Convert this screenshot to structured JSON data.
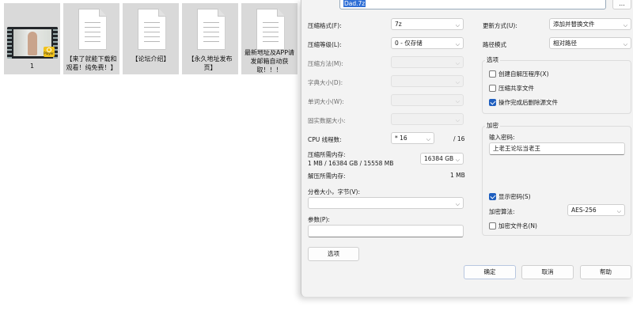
{
  "files": [
    {
      "name": "1",
      "type": "video"
    },
    {
      "name": "【来了就能下载和观看！纯免费！】",
      "type": "document"
    },
    {
      "name": "【论坛介绍】",
      "type": "document"
    },
    {
      "name": "【永久地址发布页】",
      "type": "document"
    },
    {
      "name": "最新地址及APP请发邮箱自动获取！！！",
      "type": "document"
    }
  ],
  "dialog": {
    "archive_name": "Dad.7z",
    "archive_browse": "...",
    "format_label": "压缩格式(F):",
    "format_value": "7z",
    "level_label": "压缩等级(L):",
    "level_value": "0 - 仅存储",
    "method_label": "压缩方法(M):",
    "dict_label": "字典大小(D):",
    "word_label": "单词大小(W):",
    "solid_label": "固实数据大小:",
    "cpu_label": "CPU 线程数:",
    "cpu_value": "* 16",
    "cpu_total": "/ 16",
    "mem_comp_label": "压缩所需内存:",
    "mem_comp_detail": "1 MB / 16384 GB / 15558 MB",
    "mem_comp_value": "16384 GB",
    "mem_decomp_label": "解压所需内存:",
    "mem_decomp_value": "1 MB",
    "split_label": "分卷大小，字节(V):",
    "params_label": "参数(P):",
    "options_button": "选项",
    "update_label": "更新方式(U):",
    "update_value": "添加并替换文件",
    "path_label": "路径模式",
    "path_value": "相对路径",
    "options_group": "选项",
    "opt_sfx": "创建自解压程序(X)",
    "opt_shared": "压缩共享文件",
    "opt_delete": "操作完成后删除源文件",
    "encrypt_group": "加密",
    "password_label": "输入密码:",
    "password_value": "上老王论坛当老王",
    "show_password": "显示密码(S)",
    "enc_method_label": "加密算法:",
    "enc_method_value": "AES-256",
    "enc_names": "加密文件名(N)",
    "ok": "确定",
    "cancel": "取消",
    "help": "帮助"
  }
}
